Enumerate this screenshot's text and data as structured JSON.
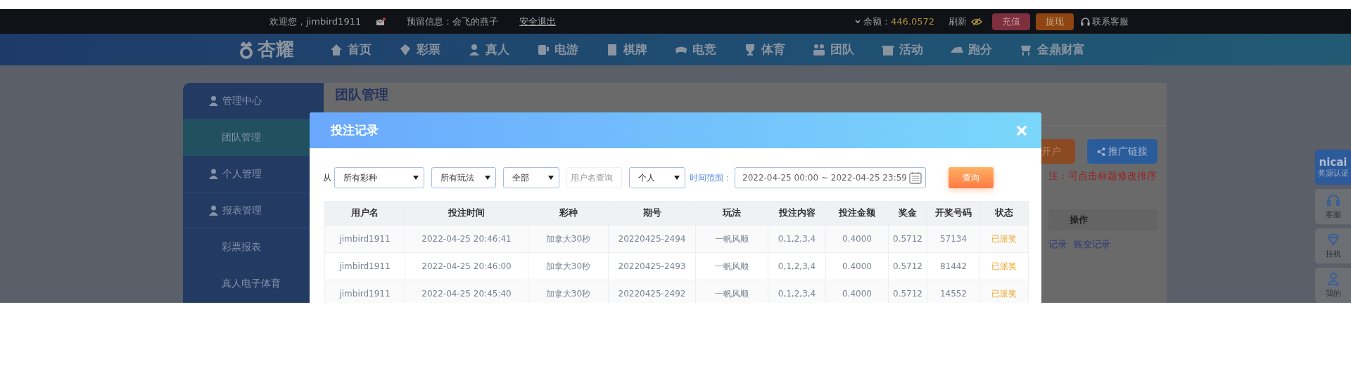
{
  "top_bar": {
    "welcome": "欢迎您，jimbird1911",
    "reserved_info": "预留信息：会飞的燕子",
    "logout": "安全退出",
    "balance_label": "余额：",
    "balance": "446.0572",
    "refresh": "刷新",
    "deposit": "充值",
    "withdraw": "提现",
    "support": "联系客服"
  },
  "logo": "杏耀",
  "nav": [
    "首页",
    "彩票",
    "真人",
    "电游",
    "棋牌",
    "电竞",
    "体育",
    "团队",
    "活动",
    "跑分",
    "金鼎财富"
  ],
  "sidebar": {
    "items": [
      {
        "label": "管理中心",
        "kind": "heading",
        "selected": false
      },
      {
        "label": "团队管理",
        "kind": "link",
        "selected": true
      },
      {
        "label": "个人管理",
        "kind": "heading",
        "selected": false
      },
      {
        "label": "报表管理",
        "kind": "heading",
        "selected": false
      },
      {
        "label": "彩票报表",
        "kind": "link",
        "selected": false
      },
      {
        "label": "真人电子体育",
        "kind": "link",
        "selected": false
      }
    ]
  },
  "page": {
    "title": "团队管理",
    "buttons": [
      "开户",
      "推广链接"
    ],
    "note": "注：可点击标题修改排序",
    "table": {
      "columns": [
        "操作"
      ],
      "links": [
        "记录",
        "账变记录"
      ]
    }
  },
  "modal": {
    "title": "投注记录",
    "filters": {
      "from_label": "从",
      "selects": [
        "所有彩种",
        "所有玩法",
        "全部"
      ],
      "username_placeholder": "用户名查询",
      "scope": "个人",
      "time_label": "时间范围：",
      "time_range": "2022-04-25 00:00 ~ 2022-04-25 23:59",
      "query_button": "查询"
    },
    "table": {
      "columns": [
        "用户名",
        "投注时间",
        "彩种",
        "期号",
        "玩法",
        "投注内容",
        "投注金额",
        "奖金",
        "开奖号码",
        "状态"
      ],
      "rows": [
        [
          "jimbird1911",
          "2022-04-25 20:46:41",
          "加拿大30秒",
          "20220425-2494",
          "一帆风顺",
          "0,1,2,3,4",
          "0.4000",
          "0.5712",
          "57134",
          "已派奖"
        ],
        [
          "jimbird1911",
          "2022-04-25 20:46:00",
          "加拿大30秒",
          "20220425-2493",
          "一帆风顺",
          "0,1,2,3,4",
          "0.4000",
          "0.5712",
          "81442",
          "已派奖"
        ],
        [
          "jimbird1911",
          "2022-04-25 20:45:40",
          "加拿大30秒",
          "20220425-2492",
          "一帆风顺",
          "0,1,2,3,4",
          "0.4000",
          "0.5712",
          "14552",
          "已派奖"
        ]
      ]
    }
  },
  "side_tools": [
    {
      "kind": "badge",
      "logo": "nicai",
      "label": "奖源认证"
    },
    {
      "kind": "tile",
      "label": "客服"
    },
    {
      "kind": "tile",
      "label": "挂机"
    },
    {
      "kind": "tile",
      "label": "我的"
    }
  ]
}
